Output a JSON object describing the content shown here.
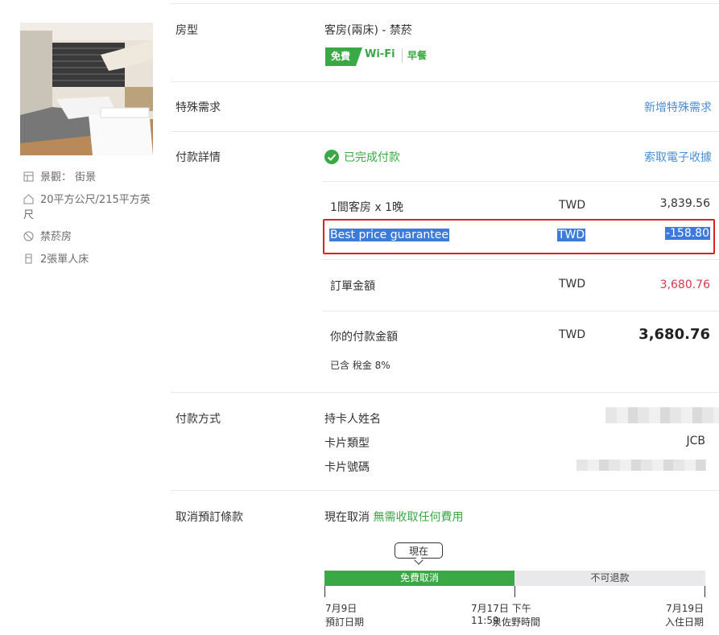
{
  "amenities": [
    {
      "icon": "view-icon",
      "label": "景觀： 街景"
    },
    {
      "icon": "area-icon",
      "label": "20平方公尺/215平方英尺"
    },
    {
      "icon": "no-smoking-icon",
      "label": "禁菸房"
    },
    {
      "icon": "bed-icon",
      "label": "2張單人床"
    }
  ],
  "room": {
    "label": "房型",
    "name": "客房(兩床) - 禁菸",
    "free_tag": "免費",
    "wifi": "Wi-Fi",
    "breakfast": "早餐"
  },
  "special": {
    "label": "特殊需求",
    "link": "新增特殊需求"
  },
  "payment": {
    "label": "付款詳情",
    "status": "已完成付款",
    "receipt_link": "索取電子收據",
    "lines": [
      {
        "desc": "1間客房 x 1晚",
        "cur": "TWD",
        "amt": "3,839.56"
      },
      {
        "desc": "Best price guarantee",
        "cur": "TWD",
        "amt": "-158.80"
      },
      {
        "desc": "訂單金額",
        "cur": "TWD",
        "amt": "3,680.76"
      },
      {
        "desc": "你的付款金額",
        "cur": "TWD",
        "amt": "3,680.76"
      }
    ],
    "tax_note": "已含 稅金 8%"
  },
  "method": {
    "label": "付款方式",
    "holder": "持卡人姓名",
    "type_label": "卡片類型",
    "type_value": "JCB",
    "number_label": "卡片號碼"
  },
  "cancel": {
    "label": "取消預訂條款",
    "now_text": "現在取消",
    "free_text": "無需收取任何費用",
    "now_marker": "現在",
    "free_segment": "免費取消",
    "nonrefund_segment": "不可退款",
    "d1": "7月9日",
    "d1_sub": "預訂日期",
    "d2": "7月17日 下午 11:59",
    "d2_sub": "泉佐野時間",
    "d3": "7月19日",
    "d3_sub": "入住日期"
  },
  "colors": {
    "accent_green": "#3aa845",
    "link_blue": "#4a8ed6",
    "price_red": "#d9394a"
  }
}
